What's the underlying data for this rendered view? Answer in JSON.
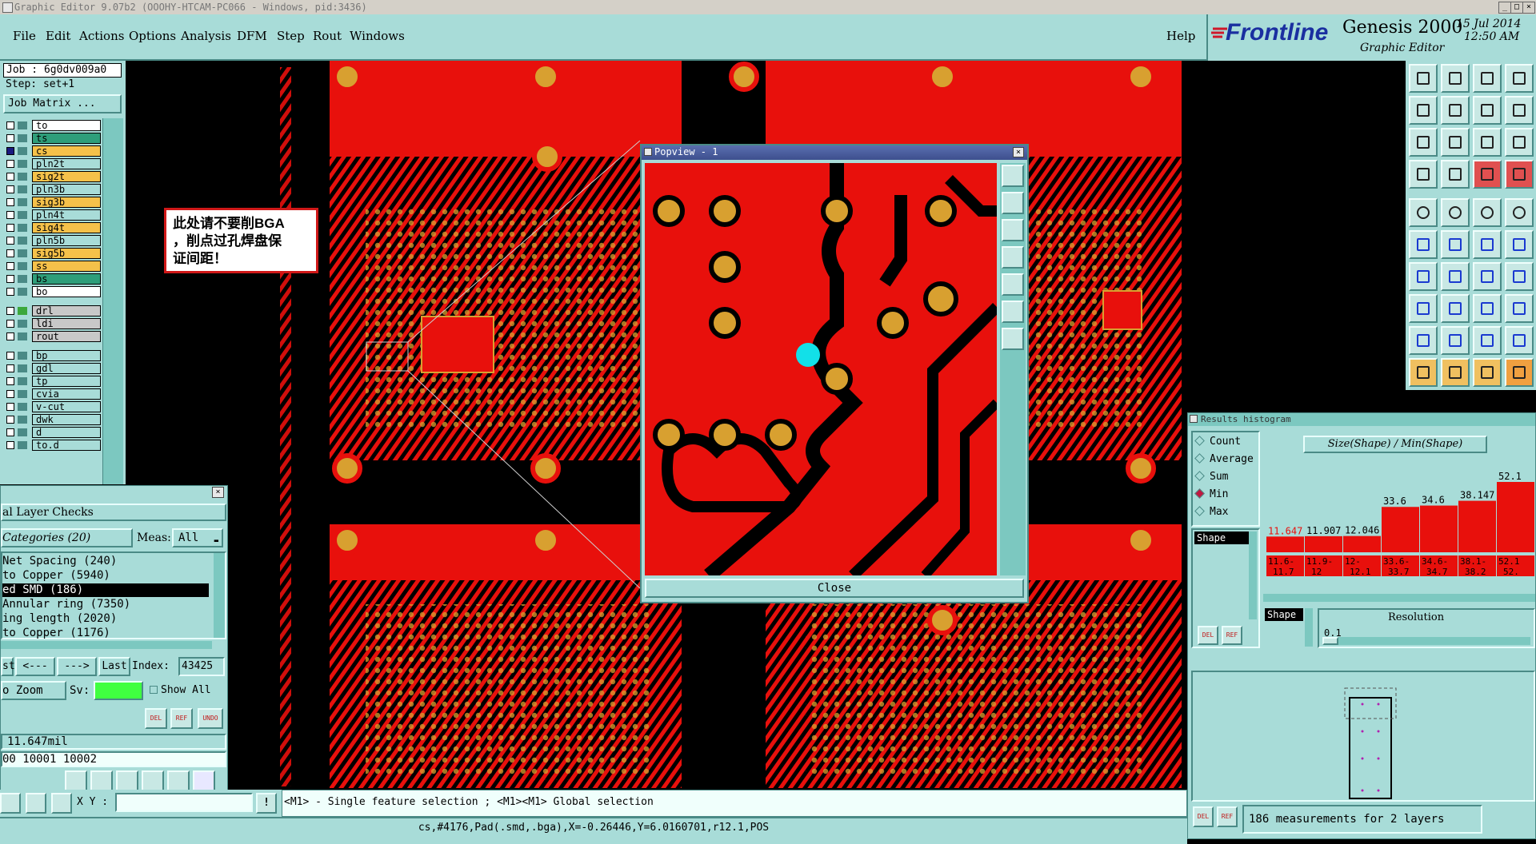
{
  "window": {
    "title": "Graphic Editor 9.07b2 (OOOHY-HTCAM-PC066 - Windows, pid:3436)",
    "minimize_glyph": "_",
    "maximize_glyph": "□",
    "close_glyph": "×"
  },
  "menu": {
    "items": [
      "File",
      "Edit",
      "Actions",
      "Options",
      "Analysis",
      "DFM",
      "Step",
      "Rout",
      "Windows"
    ],
    "help": "Help"
  },
  "brand": {
    "logo": "Frontline",
    "product": "Genesis 2000",
    "subtitle": "Graphic Editor",
    "date": "15 Jul 2014",
    "time": "12:50 AM"
  },
  "job": {
    "job_label": "Job : 6g0dv009a0",
    "step_label": "Step: set+1",
    "matrix_button": "Job Matrix ..."
  },
  "layers": [
    {
      "name": "to",
      "color": "#ffffff"
    },
    {
      "name": "ts",
      "color": "#2e9e7a"
    },
    {
      "name": "cs",
      "color": "#f5c14a"
    },
    {
      "name": "pln2t",
      "color": "#a8dcd8"
    },
    {
      "name": "sig2t",
      "color": "#f5c14a"
    },
    {
      "name": "pln3b",
      "color": "#a8dcd8"
    },
    {
      "name": "sig3b",
      "color": "#f5c14a"
    },
    {
      "name": "pln4t",
      "color": "#a8dcd8"
    },
    {
      "name": "sig4t",
      "color": "#f5c14a"
    },
    {
      "name": "pln5b",
      "color": "#a8dcd8"
    },
    {
      "name": "sig5b",
      "color": "#f5c14a"
    },
    {
      "name": "ss",
      "color": "#f5c14a"
    },
    {
      "name": "bs",
      "color": "#2e9e7a"
    },
    {
      "name": "bo",
      "color": "#ffffff"
    },
    {
      "name": "drl",
      "color": "#c8c8c8"
    },
    {
      "name": "ldi",
      "color": "#c8c8c8"
    },
    {
      "name": "rout",
      "color": "#c8c8c8"
    },
    {
      "name": "bp",
      "color": "#a8dcd8"
    },
    {
      "name": "gdl",
      "color": "#a8dcd8"
    },
    {
      "name": "tp",
      "color": "#a8dcd8"
    },
    {
      "name": "cvia",
      "color": "#a8dcd8"
    },
    {
      "name": "v-cut",
      "color": "#a8dcd8"
    },
    {
      "name": "dwk",
      "color": "#a8dcd8"
    },
    {
      "name": "d",
      "color": "#a8dcd8"
    },
    {
      "name": "to.d",
      "color": "#a8dcd8"
    }
  ],
  "note": {
    "line1": "此处请不要削BGA",
    "line2": "，削点过孔焊盘保",
    "line3": "证间距！"
  },
  "popview": {
    "title": "Popview - 1",
    "close_button": "Close"
  },
  "checks": {
    "title": "al Layer Checks",
    "categories_label": "Categories (20)",
    "meas_label": "Meas:",
    "meas_value": "All",
    "items": [
      " Net Spacing (240)",
      "to Copper (5940)",
      "ed SMD (186)",
      "Annular ring (7350)",
      "ing length (2020)",
      " to Copper (1176)"
    ],
    "selected_index": 2,
    "nav": {
      "first": "st",
      "prev": "<---",
      "next": "--->",
      "last": "Last",
      "index_label": "Index:",
      "index_value": "43425"
    },
    "zoom_label": "o Zoom",
    "sv_label": "Sv:",
    "show_all": "Show All",
    "value": "11.647mil",
    "ids": "00 10001 10002",
    "tool_buttons": [
      "DEL",
      "REF",
      "UNDO"
    ],
    "xy_label": "X Y :"
  },
  "histogram": {
    "title": "Results histogram",
    "options": [
      "Count",
      "Average",
      "Sum",
      "Min",
      "Max"
    ],
    "selected_option": "Min",
    "chart_title": "Size(Shape) / Min(Shape)",
    "list_item": "Shape",
    "resolution_label": "Resolution",
    "resolution_value": "0.1",
    "shape_label": "Shape",
    "summary": "186 measurements for 2 layers",
    "buttons": [
      "DEL",
      "REF"
    ]
  },
  "chart_data": {
    "type": "bar",
    "title": "Size(Shape) / Min(Shape)",
    "categories": [
      "11.6-11.7",
      "11.9-12",
      "12-12.1",
      "33.6-33.7",
      "34.6-34.7",
      "38.1-38.2",
      "52.1-52."
    ],
    "values": [
      11.647,
      11.907,
      12.046,
      33.6,
      34.6,
      38.147,
      52.1
    ],
    "value_labels": [
      "11.647",
      "11.907",
      "12.046",
      "33.6",
      "34.6",
      "38.147",
      "52.1"
    ],
    "tick_labels_top": [
      "11.6-",
      "11.9-",
      "12-",
      "33.6-",
      "34.6-",
      "38.1-",
      "52.1"
    ],
    "tick_labels_bottom": [
      "11.7",
      "12",
      "12.1",
      "33.7",
      "34.7",
      "38.2",
      "52."
    ],
    "highlight_index": 0,
    "ylim": [
      0,
      52.1
    ]
  },
  "status": {
    "hint": "<M1> - Single feature selection ; <M1><M1> Global selection",
    "feature": "cs,#4176,Pad(.smd,.bga),X=-0.26446,Y=6.0160701,r12.1,POS"
  }
}
